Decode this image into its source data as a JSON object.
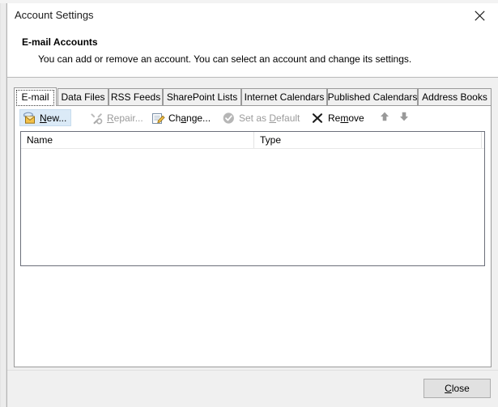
{
  "window": {
    "title": "Account Settings",
    "close_icon": "close-icon",
    "background_sliver_text": "· · ·  ·  · · ·  ·· ·  ·· · ·   ·  · ·· ·· · ··"
  },
  "header": {
    "title": "E-mail Accounts",
    "description": "You can add or remove an account. You can select an account and change its settings."
  },
  "tabs": [
    {
      "label": "E-mail",
      "selected": true
    },
    {
      "label": "Data Files",
      "selected": false
    },
    {
      "label": "RSS Feeds",
      "selected": false
    },
    {
      "label": "SharePoint Lists",
      "selected": false
    },
    {
      "label": "Internet Calendars",
      "selected": false
    },
    {
      "label": "Published Calendars",
      "selected": false
    },
    {
      "label": "Address Books",
      "selected": false
    }
  ],
  "toolbar": {
    "new": {
      "label_pre": "",
      "label_accel": "N",
      "label_post": "ew...",
      "icon": "new-account-icon",
      "enabled": true,
      "hovered": true
    },
    "repair": {
      "label_pre": "",
      "label_accel": "R",
      "label_post": "epair...",
      "icon": "repair-tools-icon",
      "enabled": false,
      "hovered": false
    },
    "change": {
      "label_pre": "Ch",
      "label_accel": "a",
      "label_post": "nge...",
      "icon": "change-account-icon",
      "enabled": true,
      "hovered": false
    },
    "set_as_default": {
      "label_pre": "Set as ",
      "label_accel": "D",
      "label_post": "efault",
      "icon": "check-circle-icon",
      "enabled": false,
      "hovered": false
    },
    "remove": {
      "label_pre": "Re",
      "label_accel": "m",
      "label_post": "ove",
      "icon": "x-mark-icon",
      "enabled": true,
      "hovered": false
    },
    "move_up": {
      "icon": "arrow-up-icon",
      "enabled": true
    },
    "move_down": {
      "icon": "arrow-down-icon",
      "enabled": true
    }
  },
  "accounts_list": {
    "columns": [
      {
        "label": "Name"
      },
      {
        "label": "Type"
      }
    ],
    "rows": []
  },
  "footer": {
    "close": {
      "label_pre": "",
      "label_accel": "C",
      "label_post": "lose"
    }
  },
  "colors": {
    "dialog_background": "#f0f0f0",
    "content_background": "#ffffff",
    "hover_highlight": "#dbeaf7",
    "listbox_border": "#6c6f7a",
    "disabled_text": "#9b9b9b"
  }
}
